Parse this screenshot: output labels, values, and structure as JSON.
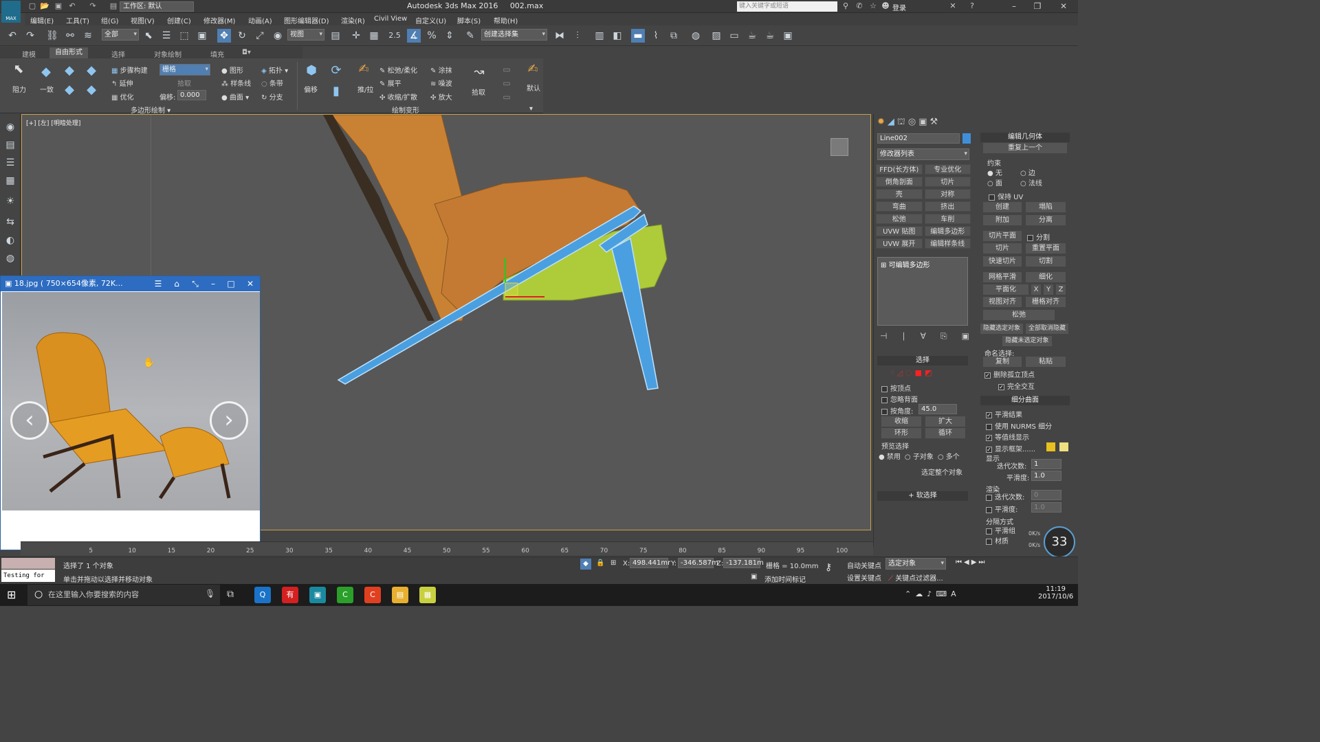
{
  "titlebar": {
    "workspace": "工作区: 默认",
    "app_title": "Autodesk 3ds Max 2016",
    "file_name": "002.max",
    "search_placeholder": "键入关键字或短语",
    "login": "登录",
    "logo": "MAX"
  },
  "menu": [
    "编辑(E)",
    "工具(T)",
    "组(G)",
    "视图(V)",
    "创建(C)",
    "修改器(M)",
    "动画(A)",
    "图形编辑器(D)",
    "渲染(R)",
    "Civil View",
    "自定义(U)",
    "脚本(S)",
    "帮助(H)"
  ],
  "main_toolbar": {
    "filter": "全部",
    "ref_coord": "视图",
    "snap_value": "2.5",
    "named_sel": "创建选择集"
  },
  "ribbon_tabs": [
    "建模",
    "自由形式",
    "选择",
    "对象绘制",
    "填充"
  ],
  "ribbon": {
    "resist": "阻力",
    "general": "一致",
    "step_build": "步骤构建",
    "extend": "延伸",
    "optimize": "优化",
    "grid": "栅格",
    "pick": "拾取",
    "offset_label": "偏移:",
    "offset_value": "0.000",
    "shape": "图形",
    "spline": "样条线",
    "surface": "曲面",
    "topology": "拓扑",
    "strip": "条带",
    "branch": "分支",
    "conform": "偏移",
    "group_label": "多边形绘制",
    "push_pull": "推/拉",
    "relax_soften": "松弛/柔化",
    "flatten": "展平",
    "shrink_expand": "收缩/扩散",
    "smear": "涂抹",
    "noise": "噪波",
    "amplify": "放大",
    "pick2": "拾取",
    "default": "默认",
    "paint_label": "绘制变形"
  },
  "viewport": {
    "label": "[+] [左] [明暗处理]"
  },
  "viewer": {
    "title": "18.jpg ( 750×654像素, 72K...",
    "prev": "‹",
    "next": "›"
  },
  "cmd_panel": {
    "object_name": "Line002",
    "modifier_list": "修改器列表",
    "mod_buttons": [
      "FFD(长方体)",
      "专业优化",
      "倒角剖面",
      "切片",
      "壳",
      "对称",
      "弯曲",
      "挤出",
      "松弛",
      "车削",
      "UVW 贴图",
      "编辑多边形",
      "UVW 展开",
      "编辑样条线"
    ],
    "stack_item": "可编辑多边形",
    "selection": {
      "header": "选择",
      "by_vertex": "按顶点",
      "ignore_back": "忽略背面",
      "by_angle": "按角度:",
      "angle_value": "45.0",
      "shrink": "收缩",
      "grow": "扩大",
      "ring": "环形",
      "loop": "循环",
      "preview": "预览选择",
      "disabled": "禁用",
      "subobj": "子对象",
      "multi": "多个",
      "whole": "选定整个对象"
    },
    "soft_select": "软选择"
  },
  "edit_geo": {
    "header": "编辑几何体",
    "repeat_last": "重复上一个",
    "constraint": "约束",
    "none": "无",
    "edge": "边",
    "face": "面",
    "normal": "法线",
    "keep_uv": "保持 UV",
    "create": "创建",
    "collapse": "塌陷",
    "attach": "附加",
    "detach": "分离",
    "slice_plane": "切片平面",
    "split": "分割",
    "slice": "切片",
    "reset_plane": "重置平面",
    "quickslice": "快速切片",
    "cut": "切割",
    "msmooth": "网格平滑",
    "tessellate": "细化",
    "make_planar": "平面化",
    "xyz": [
      "X",
      "Y",
      "Z"
    ],
    "view_align": "视图对齐",
    "grid_align": "栅格对齐",
    "relax": "松弛",
    "hide_sel": "隐藏选定对象",
    "unhide_all": "全部取消隐藏",
    "hide_unsel": "隐藏未选定对象",
    "named_sel": "命名选择:",
    "copy": "复制",
    "paste": "粘贴",
    "delete_iso": "删除孤立顶点",
    "full_interact": "完全交互",
    "subdiv_header": "细分曲面",
    "smooth_result": "平滑结果",
    "use_nurms": "使用 NURMS 细分",
    "isoline": "等值线显示",
    "show_cage": "显示框架......",
    "display": "显示",
    "iterations": "迭代次数:",
    "iter_value": "1",
    "smoothness": "平滑度:",
    "smooth_value": "1.0",
    "render": "渲染",
    "r_iter_value": "0",
    "r_smooth_value": "1.0",
    "sep_by": "分隔方式",
    "smooth_grp": "平滑组",
    "material": "材质",
    "cage_color1": "#e8c020",
    "cage_color2": "#f0e080"
  },
  "timeline": {
    "ticks": [
      "5",
      "10",
      "15",
      "20",
      "25",
      "30",
      "35",
      "40",
      "45",
      "50",
      "55",
      "60",
      "65",
      "70",
      "75",
      "80",
      "85",
      "90",
      "95",
      "100"
    ]
  },
  "status": {
    "selected": "选择了 1 个对象",
    "hint": "单击并拖动以选择并移动对象",
    "testing": "Testing for AL",
    "x_label": "X:",
    "x_value": "498.441mr",
    "y_label": "Y:",
    "y_value": "-346.587m",
    "z_label": "Z:",
    "z_value": "-137.181m",
    "grid": "栅格 = 10.0mm",
    "add_time_tag": "添加时间标记",
    "auto_key": "自动关键点",
    "set_key": "设置关键点",
    "selected_obj": "选定对象",
    "key_filters": "关键点过滤器...",
    "fps": "33",
    "net1": "0K/s",
    "net2": "0K/s"
  },
  "taskbar": {
    "search": "在这里输入你要搜索的内容",
    "time": "11:19",
    "date": "2017/10/6"
  },
  "colors": {
    "selection_blue": "#4a9fe0",
    "chair_orange": "#c47a32",
    "green_highlight": "#aecb3a"
  }
}
